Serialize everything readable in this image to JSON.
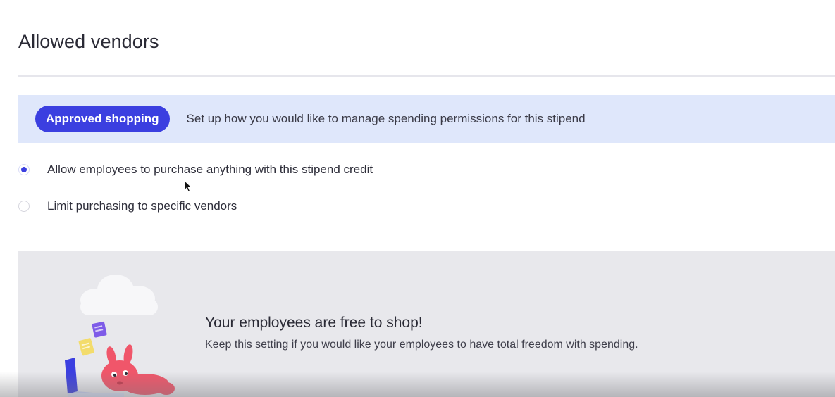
{
  "page": {
    "title": "Allowed vendors"
  },
  "banner": {
    "pill_label": "Approved shopping",
    "description": "Set up how you would like to manage spending permissions for this stipend"
  },
  "options": [
    {
      "label": "Allow employees to purchase anything with this stipend credit",
      "selected": true
    },
    {
      "label": "Limit purchasing to specific vendors",
      "selected": false
    }
  ],
  "panel": {
    "heading": "Your employees are free to shop!",
    "description": "Keep this setting if you would like your employees to have total freedom with spending."
  },
  "colors": {
    "accent": "#3b3fe0",
    "banner_bg": "#dfe7fb",
    "panel_bg": "#e8e8ec",
    "mascot": "#f0566a"
  },
  "icons": {
    "mouse_cursor": "cursor-arrow-icon",
    "illustration": "shopping-bunny-illustration"
  }
}
